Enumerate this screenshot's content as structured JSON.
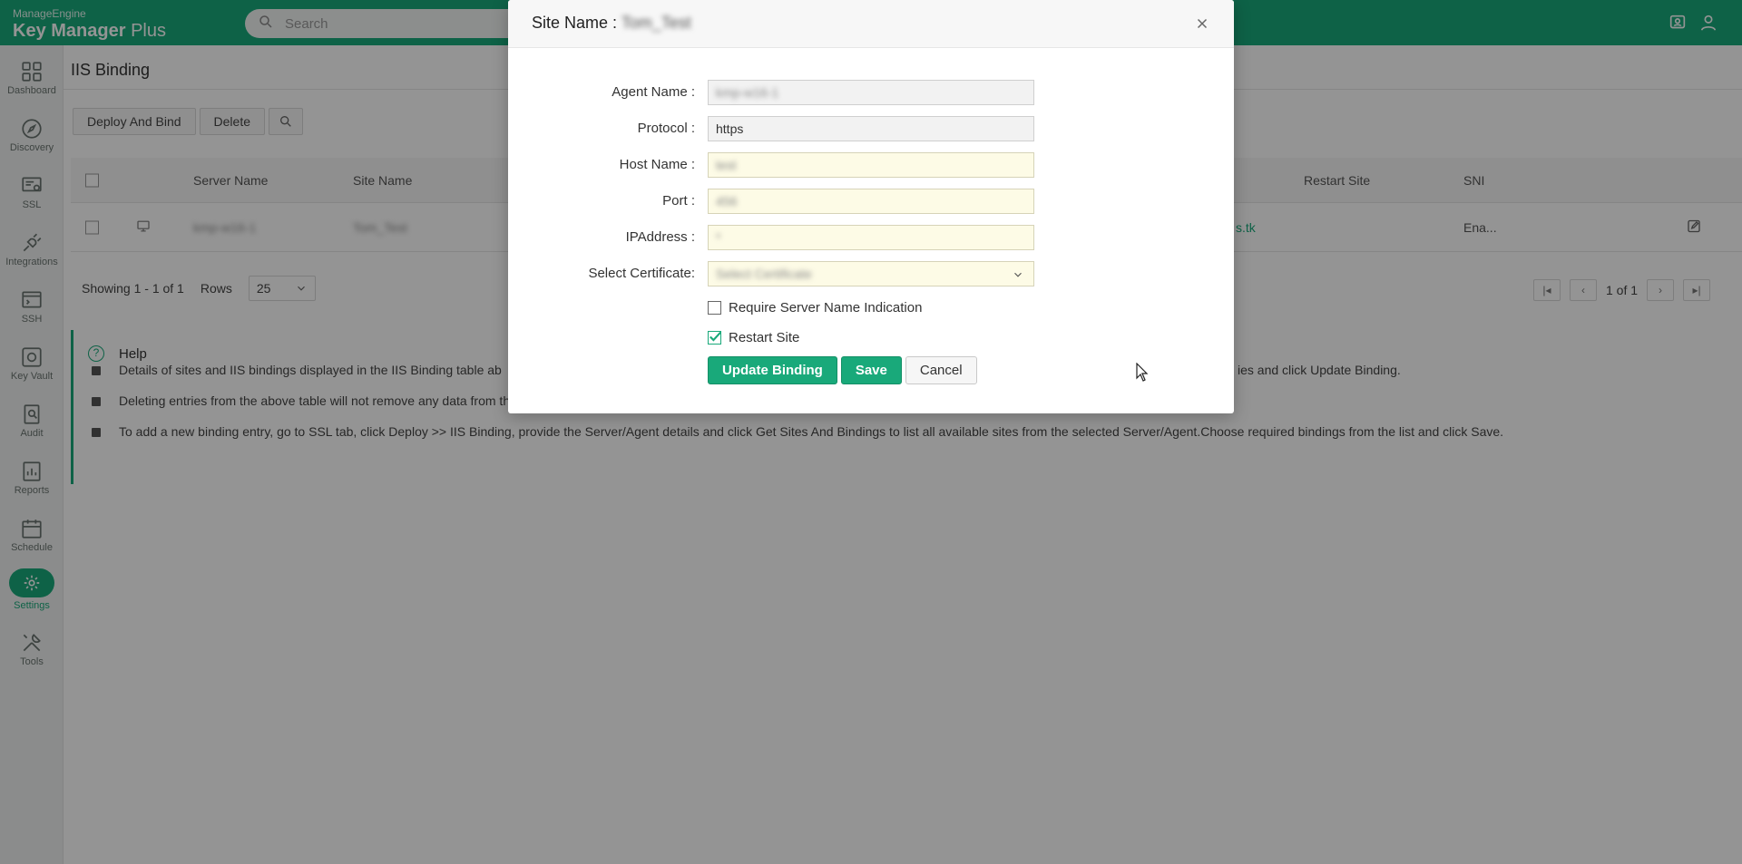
{
  "app": {
    "brand_small": "ManageEngine",
    "brand_name": "Key Manager",
    "brand_suffix": "Plus",
    "search_placeholder": "Search"
  },
  "sidebar": {
    "items": [
      {
        "label": "Dashboard",
        "icon": "grid-icon"
      },
      {
        "label": "Discovery",
        "icon": "compass-icon"
      },
      {
        "label": "SSL",
        "icon": "certificate-icon"
      },
      {
        "label": "Integrations",
        "icon": "plug-icon"
      },
      {
        "label": "SSH",
        "icon": "terminal-icon"
      },
      {
        "label": "Key Vault",
        "icon": "vault-icon"
      },
      {
        "label": "Audit",
        "icon": "audit-icon"
      },
      {
        "label": "Reports",
        "icon": "reports-icon"
      },
      {
        "label": "Schedule",
        "icon": "calendar-icon"
      },
      {
        "label": "Settings",
        "icon": "gear-icon",
        "active": true
      },
      {
        "label": "Tools",
        "icon": "tools-icon"
      }
    ]
  },
  "page": {
    "title": "IIS Binding",
    "toolbar": {
      "deploy_label": "Deploy And Bind",
      "delete_label": "Delete"
    },
    "table": {
      "headers": [
        "Server Name",
        "Site Name",
        "Restart Site",
        "SNI"
      ],
      "rows": [
        {
          "server": "kmp-w16-1",
          "site": "Tom_Test",
          "binding": "s.tk",
          "sni": "Ena..."
        }
      ]
    },
    "pager": {
      "showing": "Showing 1 - 1 of 1",
      "rows_label": "Rows",
      "rows_value": "25",
      "page_text": "1 of 1"
    },
    "help": {
      "title": "Help",
      "items": [
        "Details of sites and IIS bindings displayed in the IIS Binding table ab",
        "Deleting entries from the above table will not remove any data from the IIS server.",
        "To add a new binding entry, go to SSL tab, click Deploy >> IIS Binding, provide the Server/Agent details and click Get Sites And Bindings to list all available sites from the selected Server/Agent.Choose required bindings from the list and click Save."
      ],
      "item1_tail": "ies and click Update Binding."
    }
  },
  "modal": {
    "title_label": "Site Name :",
    "title_value": "Tom_Test",
    "fields": {
      "agent_label": "Agent Name :",
      "agent_value": "kmp-w16-1",
      "protocol_label": "Protocol :",
      "protocol_value": "https",
      "host_label": "Host Name :",
      "host_value": "test",
      "port_label": "Port :",
      "port_value": "456",
      "ip_label": "IPAddress :",
      "ip_value": "*",
      "cert_label": "Select Certificate:",
      "cert_value": "Select Certificate"
    },
    "checkboxes": {
      "sni_label": "Require Server Name Indication",
      "sni_checked": false,
      "restart_label": "Restart Site",
      "restart_checked": true
    },
    "buttons": {
      "update_label": "Update Binding",
      "save_label": "Save",
      "cancel_label": "Cancel"
    }
  },
  "colors": {
    "accent": "#19a97a",
    "overlay": "rgba(0,0,0,0.42)"
  }
}
